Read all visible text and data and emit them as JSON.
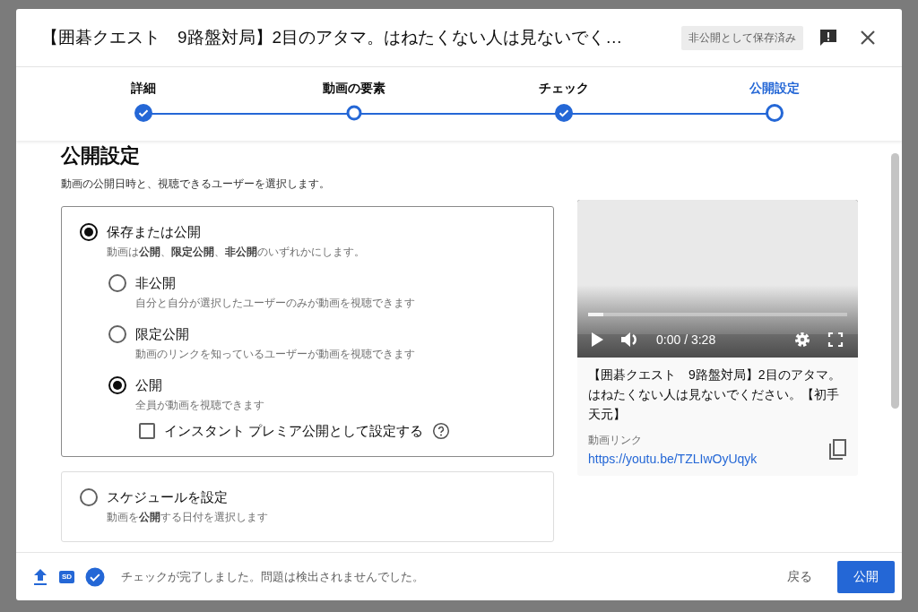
{
  "dialog": {
    "title": "【囲碁クエスト　9路盤対局】2目のアタマ。はねたくない人は見ないでく…",
    "badge": "非公開として保存済み"
  },
  "steps": [
    {
      "label": "詳細",
      "kind": "done",
      "selected": false
    },
    {
      "label": "動画の要素",
      "kind": "visited",
      "selected": false
    },
    {
      "label": "チェック",
      "kind": "done",
      "selected": false
    },
    {
      "label": "公開設定",
      "kind": "current",
      "selected": true
    }
  ],
  "section": {
    "heading": "公開設定",
    "description": "動画の公開日時と、視聴できるユーザーを選択します。"
  },
  "save_option": {
    "label": "保存または公開",
    "description": "動画は**公開**、**限定公開**、**非公開**のいずれかにします。",
    "selected": true,
    "choices": [
      {
        "label": "非公開",
        "description": "自分と自分が選択したユーザーのみが動画を視聴できます",
        "selected": false
      },
      {
        "label": "限定公開",
        "description": "動画のリンクを知っているユーザーが動画を視聴できます",
        "selected": false
      },
      {
        "label": "公開",
        "description": "全員が動画を視聴できます",
        "selected": true
      }
    ],
    "premiere": {
      "label": "インスタント プレミア公開として設定する",
      "checked": false
    }
  },
  "schedule_option": {
    "label": "スケジュールを設定",
    "description": "動画を**公開**する日付を選択します",
    "selected": false
  },
  "preview": {
    "kind": "picture",
    "progress": {
      "level": 0.06
    },
    "time": "0:00 / 3:28",
    "title": "【囲碁クエスト　9路盤対局】2目のアタマ。はねたくない人は見ないでください。【初手天元】",
    "link_label": "動画リンク",
    "link": "https://youtu.be/TZLIwOyUqyk"
  },
  "footer": {
    "quality_badge": "SD",
    "status": "チェックが完了しました。問題は検出されませんでした。",
    "back": "戻る",
    "publish": "公開"
  }
}
